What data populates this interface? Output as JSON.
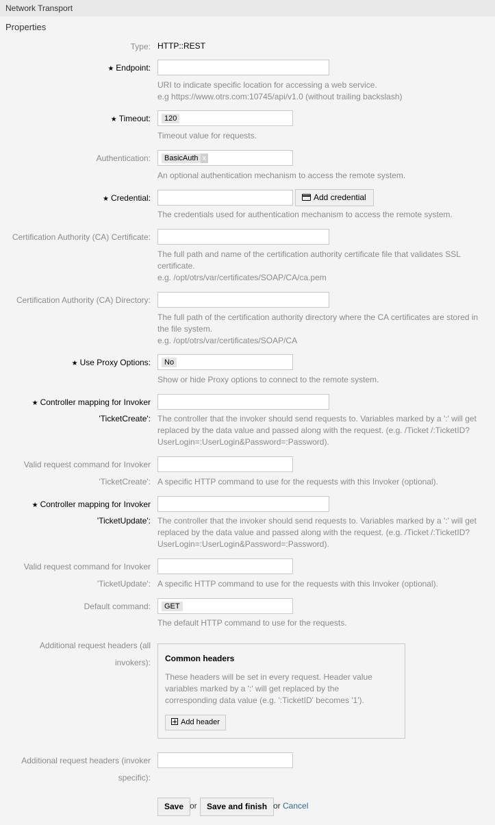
{
  "header": {
    "title": "Network Transport"
  },
  "section": {
    "title": "Properties"
  },
  "type": {
    "label": "Type:",
    "value": "HTTP::REST"
  },
  "endpoint": {
    "label": "Endpoint:",
    "value": "",
    "help_line1": "URI to indicate specific location for accessing a web service.",
    "help_line2": "e.g https://www.otrs.com:10745/api/v1.0 (without trailing backslash)"
  },
  "timeout": {
    "label": "Timeout:",
    "value": "120",
    "help": "Timeout value for requests."
  },
  "authentication": {
    "label": "Authentication:",
    "value": "BasicAuth",
    "remove": "x",
    "help": "An optional authentication mechanism to access the remote system."
  },
  "credential": {
    "label": "Credential:",
    "value": "",
    "add_button": "Add credential",
    "help": "The credentials used for authentication mechanism to access the remote system."
  },
  "ca_certificate": {
    "label": "Certification Authority (CA) Certificate:",
    "value": "",
    "help_line1": "The full path and name of the certification authority certificate file that validates SSL certificate.",
    "help_line2": "e.g. /opt/otrs/var/certificates/SOAP/CA/ca.pem"
  },
  "ca_directory": {
    "label": "Certification Authority (CA) Directory:",
    "value": "",
    "help_line1": "The full path of the certification authority directory where the CA certificates are stored in the file system.",
    "help_line2": "e.g. /opt/otrs/var/certificates/SOAP/CA"
  },
  "use_proxy": {
    "label": "Use Proxy Options:",
    "value": "No",
    "help": "Show or hide Proxy options to connect to the remote system."
  },
  "controller_ticketcreate": {
    "label_line1": "Controller mapping for Invoker",
    "label_line2": "'TicketCreate':",
    "value": "",
    "help": "The controller that the invoker should send requests to. Variables marked by a ':' will get replaced by the data value and passed along with the request. (e.g. /Ticket /:TicketID?UserLogin=:UserLogin&Password=:Password)."
  },
  "command_ticketcreate": {
    "label_line1": "Valid request command for Invoker",
    "label_line2": "'TicketCreate':",
    "value": "",
    "help": "A specific HTTP command to use for the requests with this Invoker (optional)."
  },
  "controller_ticketupdate": {
    "label_line1": "Controller mapping for Invoker",
    "label_line2": "'TicketUpdate':",
    "value": "",
    "help": "The controller that the invoker should send requests to. Variables marked by a ':' will get replaced by the data value and passed along with the request. (e.g. /Ticket /:TicketID?UserLogin=:UserLogin&Password=:Password)."
  },
  "command_ticketupdate": {
    "label_line1": "Valid request command for Invoker",
    "label_line2": "'TicketUpdate':",
    "value": "",
    "help": "A specific HTTP command to use for the requests with this Invoker (optional)."
  },
  "default_command": {
    "label": "Default command:",
    "value": "GET",
    "help": "The default HTTP command to use for the requests."
  },
  "common_headers": {
    "label_line1": "Additional request headers (all",
    "label_line2": "invokers):",
    "title": "Common headers",
    "text": "These headers will be set in every request. Header value variables marked by a ':' will get replaced by the corresponding data value (e.g. ':TicketID' becomes '1').",
    "add_button": "Add header"
  },
  "invoker_headers": {
    "label_line1": "Additional request headers (invoker",
    "label_line2": "specific):",
    "value": ""
  },
  "actions": {
    "save": "Save",
    "or1": "or",
    "save_finish": "Save and finish",
    "or2": "or",
    "cancel": "Cancel"
  },
  "required_marker": "★",
  "colors": {
    "link": "#336699",
    "muted": "#8b8b8b",
    "background": "#f4f4f4",
    "header": "#e8e8e8"
  }
}
